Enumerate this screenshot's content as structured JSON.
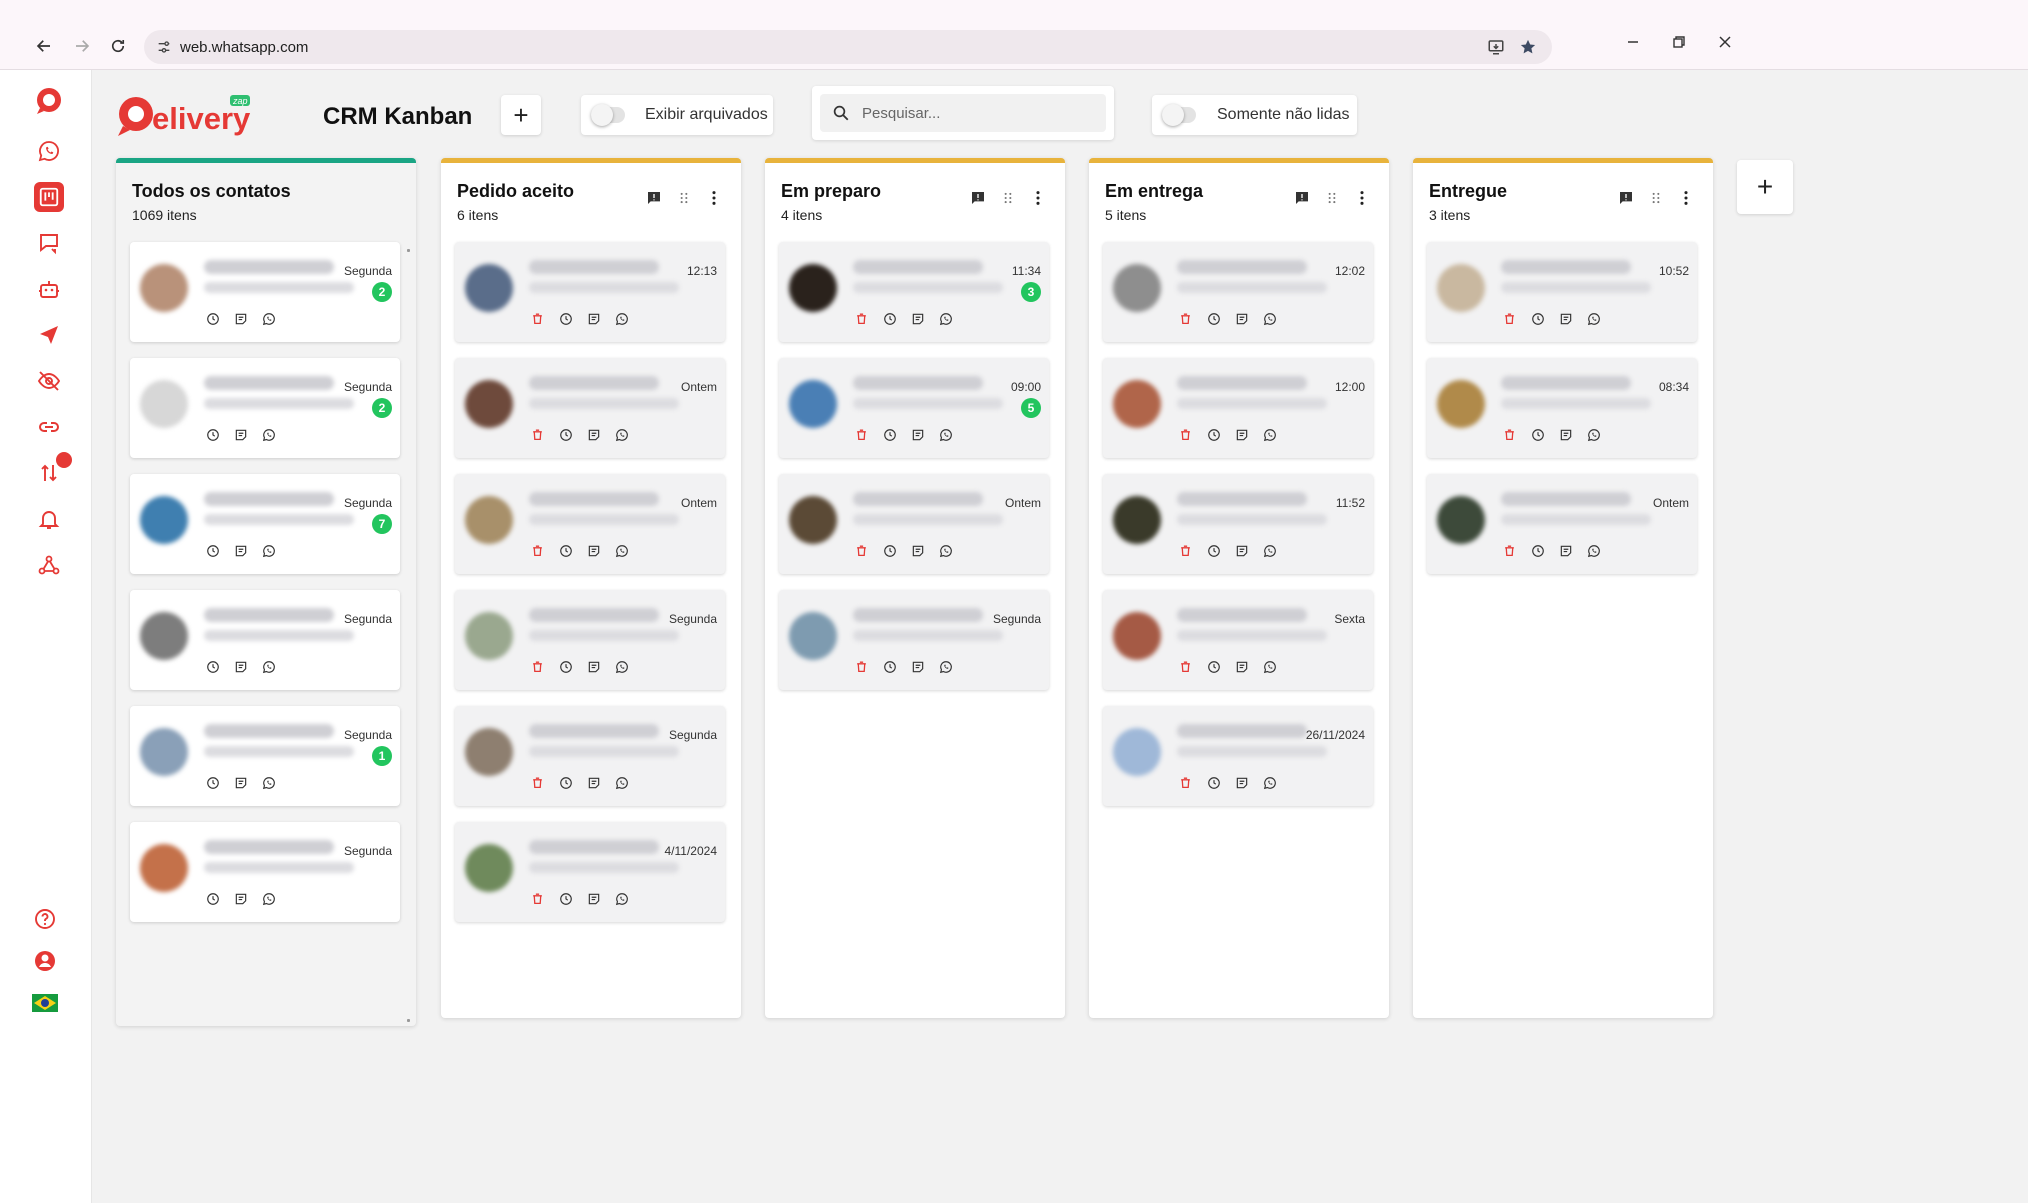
{
  "browser": {
    "url": "web.whatsapp.com"
  },
  "header": {
    "logo_text": "elivery",
    "logo_badge": "zap",
    "title": "CRM Kanban",
    "add_label": "+",
    "archived_toggle_label": "Exibir arquivados",
    "search_placeholder": "Pesquisar...",
    "unread_toggle_label": "Somente não lidas",
    "add_column_label": "+"
  },
  "colors": {
    "accent": "#e53935",
    "all_contacts_bar": "#1aa584",
    "stage_bar": "#e8b33c",
    "unread_badge": "#22c55e"
  },
  "sidebar_icons": [
    "delivery-logo-icon",
    "whatsapp-icon",
    "kanban-icon",
    "chat-icon",
    "robot-icon",
    "send-icon",
    "eye-off-icon",
    "link-icon",
    "sort-icon",
    "bell-icon",
    "webhook-icon",
    "help-icon",
    "account-icon",
    "brazil-flag-icon"
  ],
  "columns": [
    {
      "title": "Todos os contatos",
      "count": "1069 itens",
      "cards": [
        {
          "time": "Segunda",
          "badge": "2"
        },
        {
          "time": "Segunda",
          "badge": "2"
        },
        {
          "time": "Segunda",
          "badge": "7"
        },
        {
          "time": "Segunda",
          "badge": ""
        },
        {
          "time": "Segunda",
          "badge": "1"
        },
        {
          "time": "Segunda",
          "badge": ""
        }
      ]
    },
    {
      "title": "Pedido aceito",
      "count": "6 itens",
      "cards": [
        {
          "time": "12:13",
          "badge": ""
        },
        {
          "time": "Ontem",
          "badge": ""
        },
        {
          "time": "Ontem",
          "badge": ""
        },
        {
          "time": "Segunda",
          "badge": ""
        },
        {
          "time": "Segunda",
          "badge": ""
        },
        {
          "time": "4/11/2024",
          "badge": ""
        }
      ]
    },
    {
      "title": "Em preparo",
      "count": "4 itens",
      "cards": [
        {
          "time": "11:34",
          "badge": "3"
        },
        {
          "time": "09:00",
          "badge": "5"
        },
        {
          "time": "Ontem",
          "badge": ""
        },
        {
          "time": "Segunda",
          "badge": ""
        }
      ]
    },
    {
      "title": "Em entrega",
      "count": "5 itens",
      "cards": [
        {
          "time": "12:02",
          "badge": ""
        },
        {
          "time": "12:00",
          "badge": ""
        },
        {
          "time": "11:52",
          "badge": ""
        },
        {
          "time": "Sexta",
          "badge": ""
        },
        {
          "time": "26/11/2024",
          "badge": ""
        }
      ]
    },
    {
      "title": "Entregue",
      "count": "3 itens",
      "cards": [
        {
          "time": "10:52",
          "badge": ""
        },
        {
          "time": "08:34",
          "badge": ""
        },
        {
          "time": "Ontem",
          "badge": ""
        }
      ]
    }
  ]
}
